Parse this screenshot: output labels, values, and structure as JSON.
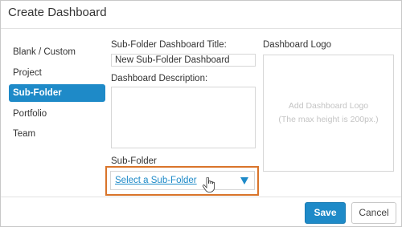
{
  "dialog": {
    "title": "Create Dashboard"
  },
  "sidebar": {
    "items": [
      {
        "label": "Blank / Custom",
        "active": false
      },
      {
        "label": "Project",
        "active": false
      },
      {
        "label": "Sub-Folder",
        "active": true
      },
      {
        "label": "Portfolio",
        "active": false
      },
      {
        "label": "Team",
        "active": false
      }
    ]
  },
  "form": {
    "title_label": "Sub-Folder Dashboard Title:",
    "title_value": "New Sub-Folder Dashboard",
    "description_label": "Dashboard Description:",
    "description_value": "",
    "subfolder_label": "Sub-Folder",
    "subfolder_select": "Select a Sub-Folder",
    "logo_label": "Dashboard Logo",
    "logo_placeholder_line1": "Add Dashboard Logo",
    "logo_placeholder_line2": "(The max height is 200px.)"
  },
  "footer": {
    "save_label": "Save",
    "cancel_label": "Cancel"
  },
  "colors": {
    "accent": "#1e8ac8",
    "highlight_border": "#d9742a"
  },
  "icons": {
    "select_arrow": "chevron-down-icon",
    "cursor": "hand-pointer-icon"
  }
}
